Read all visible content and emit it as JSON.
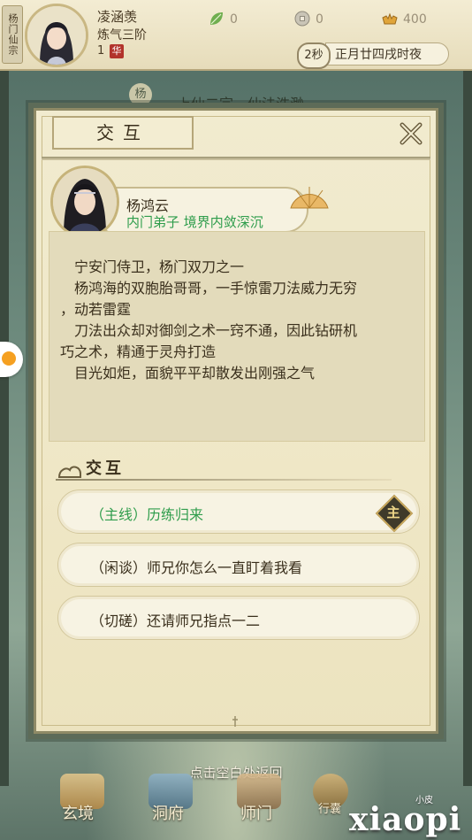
{
  "player": {
    "sect": "杨门仙宗",
    "name": "凌涵羡",
    "realm": "炼气三阶",
    "level": "1",
    "badge": "华"
  },
  "resources": [
    {
      "icon": "leaf-icon",
      "value": "0"
    },
    {
      "icon": "coin-icon",
      "value": "0"
    },
    {
      "icon": "gold-ingot-icon",
      "value": "400"
    }
  ],
  "time": {
    "countdown": "2秒",
    "date": "正月廿四戌时夜"
  },
  "background": {
    "banner": "上仙二宗，仙法浩渺",
    "tag": "杨"
  },
  "dialog": {
    "title": "交互",
    "npc": {
      "name": "杨鸿云",
      "title": "内门弟子 境界内敛深沉"
    },
    "description": [
      "宁安门侍卫，杨门双刀之一",
      "杨鸿海的双胞胎哥哥，一手惊雷刀法威力无穷",
      "，动若雷霆",
      "刀法出众却对御剑之术一窍不通，因此钻研机",
      "巧之术，精通于灵舟打造",
      "目光如炬，面貌平平却散发出刚强之气"
    ],
    "section_title": "交互",
    "options": [
      {
        "label": "（主线）历练归来",
        "badge": "主"
      },
      {
        "label": "（闲谈）师兄你怎么一直盯着我看"
      },
      {
        "label": "（切磋）还请师兄指点一二"
      }
    ]
  },
  "footer": {
    "hint": "点击空白处返回",
    "nav": [
      "玄境",
      "洞府",
      "师门",
      "行囊"
    ],
    "brand": "xiaopi",
    "brand_small": "小皮"
  }
}
